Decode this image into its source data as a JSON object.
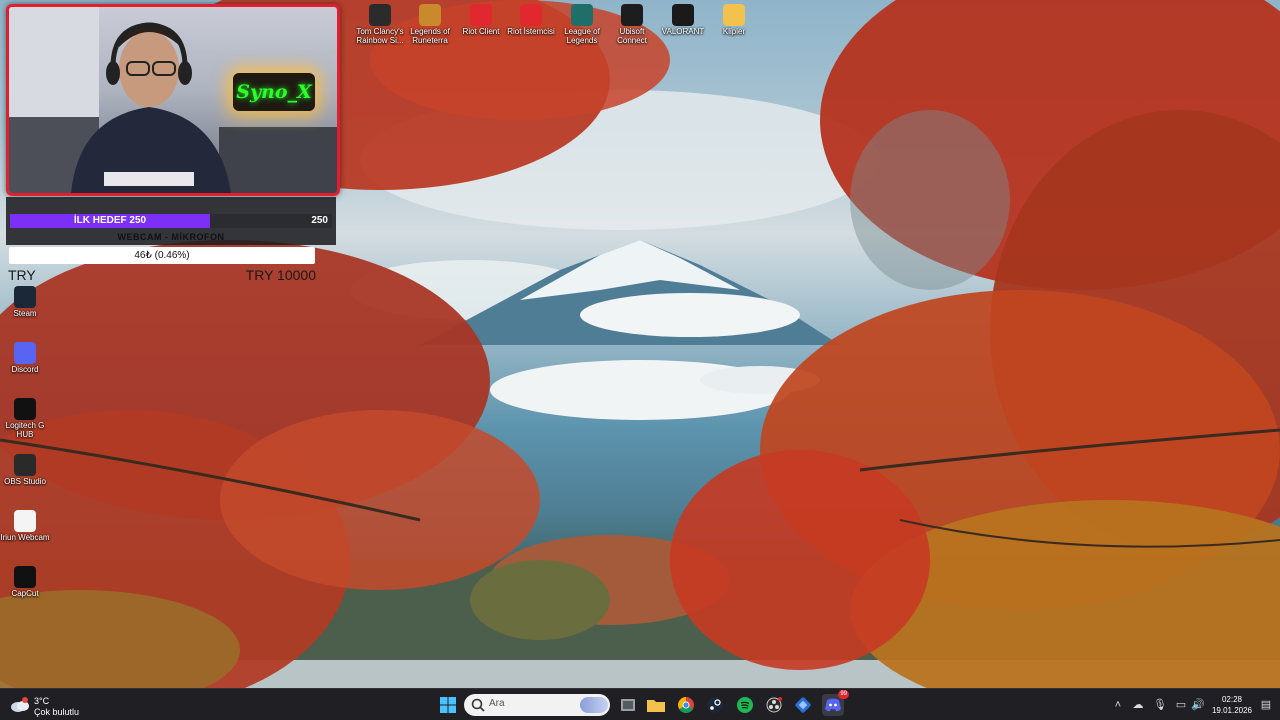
{
  "overlay": {
    "webcam_name": "Syno_X",
    "goal": {
      "label": "İLK HEDEF 250",
      "count": "250",
      "progress": 0.62
    },
    "webcam_mic": "WEBCAM - MİKROFON",
    "donation": "46₺ (0.46%)",
    "amount_left": "TRY",
    "amount_right": "TRY 10000"
  },
  "desktop": {
    "top_icons": [
      {
        "label": "Tom Clancy's Rainbow Si...",
        "icon": "rainbow-six-icon",
        "color": "#2b2b2b"
      },
      {
        "label": "Legends of Runeterra",
        "icon": "runeterra-icon",
        "color": "#c88a2a"
      },
      {
        "label": "Riot Client",
        "icon": "riot-icon",
        "color": "#e0282e"
      },
      {
        "label": "Riot İstemcisi",
        "icon": "riot-icon",
        "color": "#e0282e"
      },
      {
        "label": "League of Legends",
        "icon": "league-icon",
        "color": "#1f6e6a"
      },
      {
        "label": "Ubisoft Connect",
        "icon": "ubisoft-icon",
        "color": "#1d1d1d"
      },
      {
        "label": "VALORANT",
        "icon": "valorant-icon",
        "color": "#1a1a1a"
      },
      {
        "label": "Klipler",
        "icon": "folder-icon",
        "color": "#f2c14e"
      }
    ],
    "left_icons": [
      {
        "label": "Steam",
        "icon": "steam-icon",
        "color": "#1b2838"
      },
      {
        "label": "Discord",
        "icon": "discord-icon",
        "color": "#5865f2"
      },
      {
        "label": "Logitech G HUB",
        "icon": "logitech-icon",
        "color": "#111111"
      },
      {
        "label": "OBS Studio",
        "icon": "obs-icon",
        "color": "#2a2a2a"
      },
      {
        "label": "Iriun Webcam",
        "icon": "iriun-icon",
        "color": "#f4f4f4"
      },
      {
        "label": "CapCut",
        "icon": "capcut-icon",
        "color": "#111111"
      }
    ]
  },
  "taskbar": {
    "weather": {
      "temp": "3°C",
      "condition": "Çok bulutlu"
    },
    "search_placeholder": "Ara",
    "clock": {
      "time": "02:28",
      "date": "19.01.2026"
    },
    "discord_badge": "99"
  }
}
